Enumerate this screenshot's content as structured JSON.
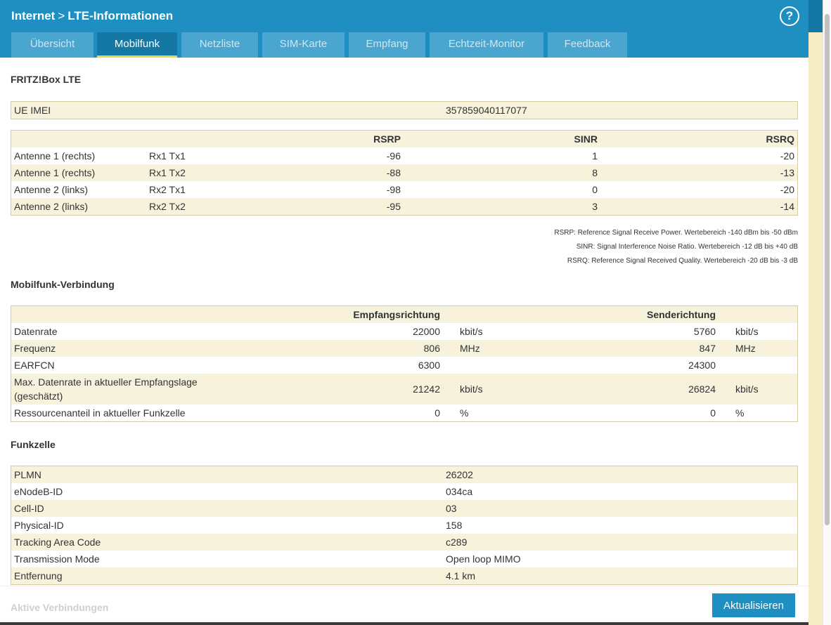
{
  "header": {
    "crumb_1": "Internet",
    "crumb_sep": ">",
    "crumb_2": "LTE-Informationen",
    "help_symbol": "?"
  },
  "tabs": [
    "Übersicht",
    "Mobilfunk",
    "Netzliste",
    "SIM-Karte",
    "Empfang",
    "Echtzeit-Monitor",
    "Feedback"
  ],
  "active_tab": "Mobilfunk",
  "fritzbox": {
    "title": "FRITZ!Box LTE",
    "imei_label": "UE IMEI",
    "imei_value": "357859040117077",
    "columns": [
      "RSRP",
      "SINR",
      "RSRQ"
    ],
    "antennas": [
      {
        "name": "Antenne 1 (rechts)",
        "path": "Rx1 Tx1",
        "rsrp": "-96",
        "sinr": "1",
        "rsrq": "-20"
      },
      {
        "name": "Antenne 1 (rechts)",
        "path": "Rx1 Tx2",
        "rsrp": "-88",
        "sinr": "8",
        "rsrq": "-13"
      },
      {
        "name": "Antenne 2 (links)",
        "path": "Rx2 Tx1",
        "rsrp": "-98",
        "sinr": "0",
        "rsrq": "-20"
      },
      {
        "name": "Antenne 2 (links)",
        "path": "Rx2 Tx2",
        "rsrp": "-95",
        "sinr": "3",
        "rsrq": "-14"
      }
    ],
    "notes": [
      "RSRP: Reference Signal Receive Power. Wertebereich -140 dBm bis -50 dBm",
      "SINR: Signal Interference Noise Ratio. Wertebereich -12 dB bis +40 dB",
      "RSRQ: Reference Signal Received Quality. Wertebereich -20 dB bis -3 dB"
    ]
  },
  "connection": {
    "title": "Mobilfunk-Verbindung",
    "col_rx": "Empfangsrichtung",
    "col_tx": "Senderichtung",
    "rows": [
      {
        "label": "Datenrate",
        "rx": "22000",
        "rx_unit": "kbit/s",
        "tx": "5760",
        "tx_unit": "kbit/s"
      },
      {
        "label": "Frequenz",
        "rx": "806",
        "rx_unit": "MHz",
        "tx": "847",
        "tx_unit": "MHz"
      },
      {
        "label": "EARFCN",
        "rx": "6300",
        "rx_unit": "",
        "tx": "24300",
        "tx_unit": ""
      },
      {
        "label": "Max. Datenrate in aktueller Empfangslage",
        "label_2": "(geschätzt)",
        "rx": "21242",
        "rx_unit": "kbit/s",
        "tx": "26824",
        "tx_unit": "kbit/s"
      },
      {
        "label": "Ressourcenanteil in aktueller Funkzelle",
        "rx": "0",
        "rx_unit": "%",
        "tx": "0",
        "tx_unit": "%"
      }
    ]
  },
  "cell": {
    "title": "Funkzelle",
    "rows": [
      {
        "label": "PLMN",
        "value": "26202"
      },
      {
        "label": "eNodeB-ID",
        "value": "034ca"
      },
      {
        "label": "Cell-ID",
        "value": "03"
      },
      {
        "label": "Physical-ID",
        "value": "158"
      },
      {
        "label": "Tracking Area Code",
        "value": "c289"
      },
      {
        "label": "Transmission Mode",
        "value": "Open loop MIMO"
      },
      {
        "label": "Entfernung",
        "value": "4.1 km"
      }
    ]
  },
  "footer": {
    "faded_title": "Aktive Verbindungen",
    "refresh_label": "Aktualisieren"
  },
  "colors": {
    "header": "#1e8fc0",
    "tab": "#4aa6cf",
    "tab_active": "#1577a3",
    "tab_indicator": "#e6d84a",
    "row_alt": "#f7f2dc",
    "border": "#d5cca6"
  }
}
